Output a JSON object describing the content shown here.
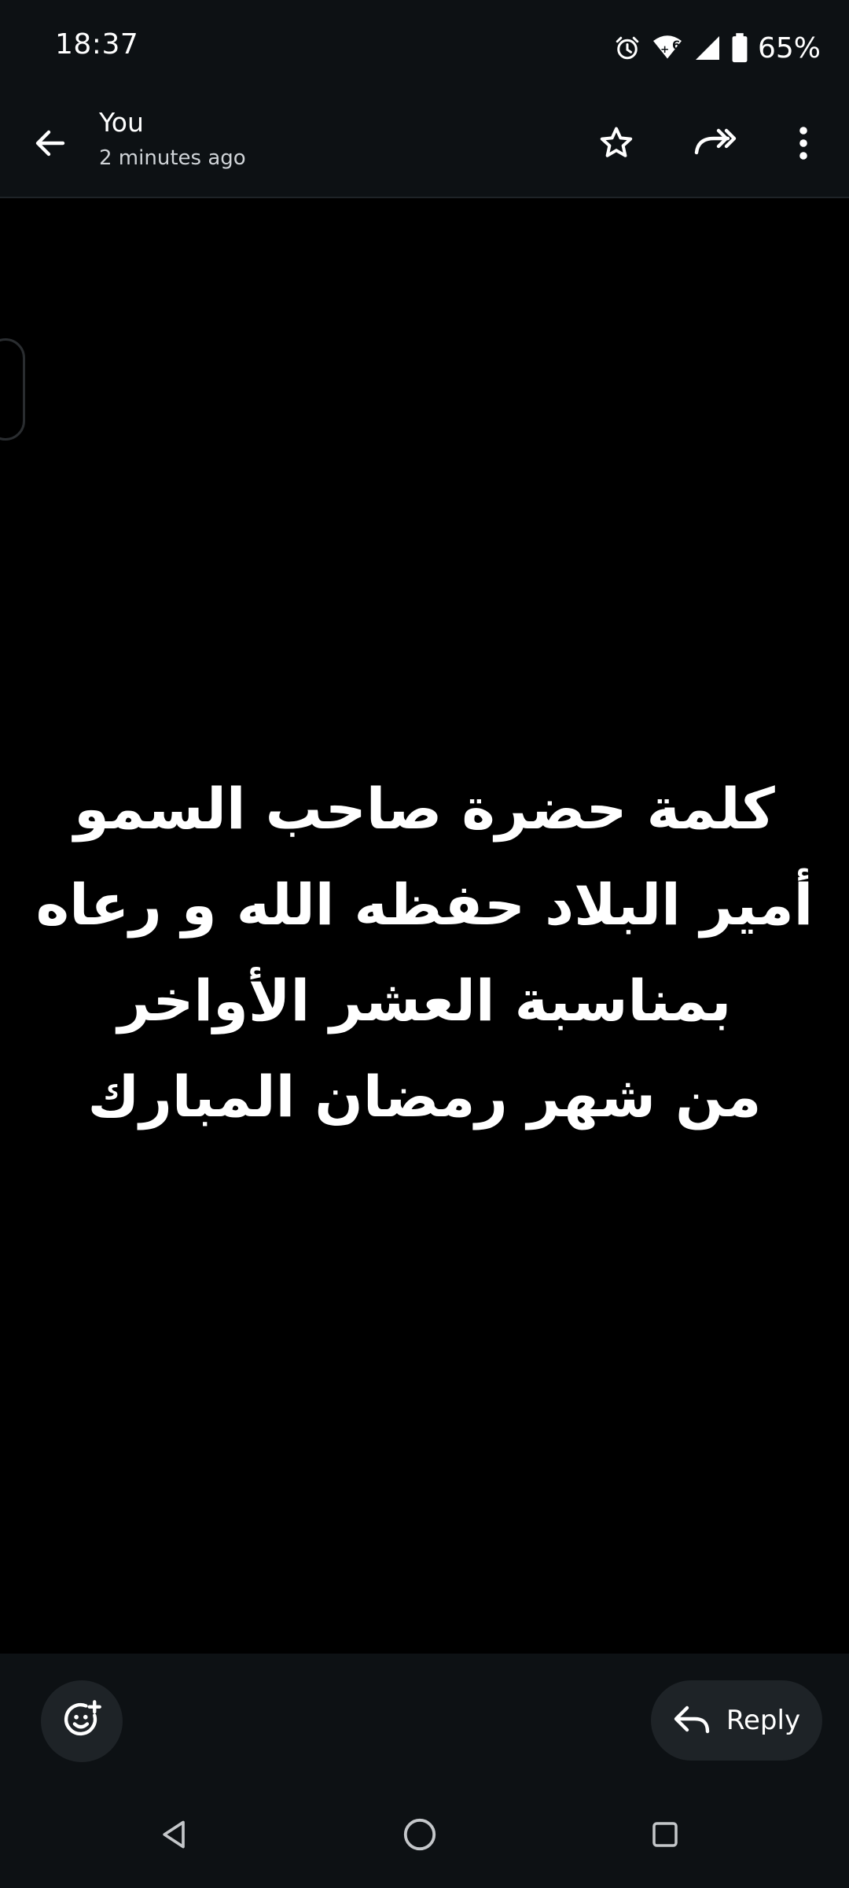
{
  "status_bar": {
    "time": "18:37",
    "battery_percent": "65%",
    "icons": [
      "alarm-icon",
      "wifi-6-icon",
      "cell-signal-icon",
      "battery-icon"
    ]
  },
  "header": {
    "sender": "You",
    "time_ago": "2 minutes ago",
    "actions": [
      "back-arrow-icon",
      "star-icon",
      "forward-icon",
      "more-vert-icon"
    ]
  },
  "message": {
    "lines": [
      "كلمة حضرة صاحب السمو",
      "أمير البلاد حفظه الله و رعاه",
      "بمناسبة العشر الأواخر",
      "من شهر رمضان المبارك"
    ]
  },
  "action_bar": {
    "reply_label": "Reply",
    "emoji_icon": "add-reaction-icon",
    "reply_icon": "reply-icon"
  },
  "nav_bar": {
    "buttons": [
      "nav-back-icon",
      "nav-home-icon",
      "nav-recents-icon"
    ]
  },
  "colors": {
    "bar_background": "#0d1114",
    "media_background": "#000000",
    "button_background": "#1e2327",
    "text": "#ffffff"
  }
}
